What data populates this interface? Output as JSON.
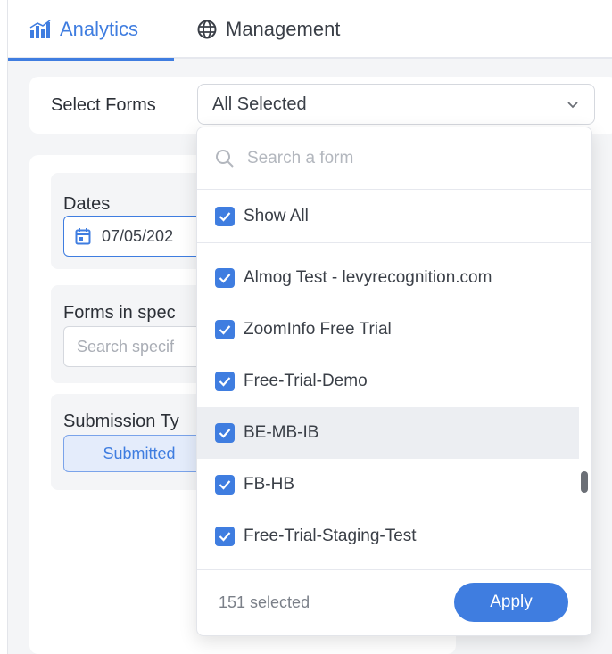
{
  "tabs": [
    {
      "label": "Analytics",
      "icon": "bar-chart-icon",
      "active": true
    },
    {
      "label": "Management",
      "icon": "globe-icon",
      "active": false
    }
  ],
  "select_forms": {
    "label": "Select Forms",
    "value": "All Selected"
  },
  "left": {
    "dates_title": "Dates",
    "date_value": "07/05/202",
    "forms_title": "Forms in spec",
    "forms_placeholder": "Search specif",
    "submission_title": "Submission Ty",
    "submitted_label": "Submitted"
  },
  "dropdown": {
    "search_placeholder": "Search a form",
    "show_all_label": "Show All",
    "items": [
      "Almog Test - levyrecognition.com",
      "ZoomInfo Free Trial",
      "Free-Trial-Demo",
      "BE-MB-IB",
      "FB-HB",
      "Free-Trial-Staging-Test"
    ],
    "selected_count": "151 selected",
    "apply_label": "Apply"
  },
  "colors": {
    "accent": "#3f7de0",
    "hover_row": "#eceef2"
  }
}
